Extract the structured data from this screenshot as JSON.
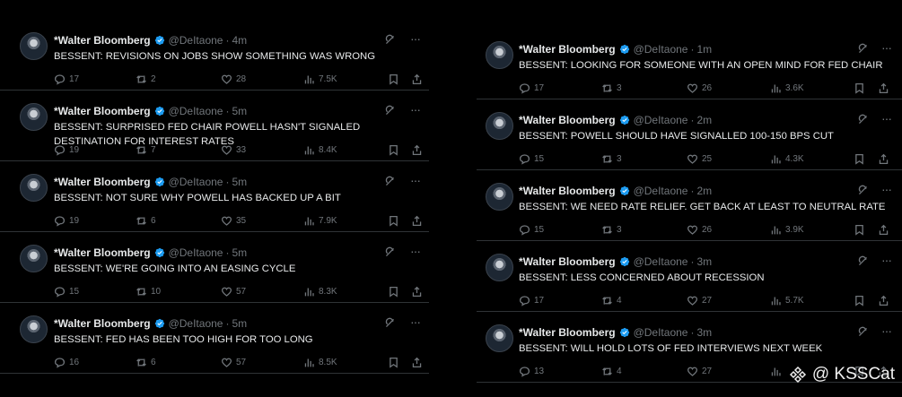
{
  "left_column": [
    {
      "name": "*Walter Bloomberg",
      "handle": "@DeItaone",
      "time": "4m",
      "text": "BESSENT: REVISIONS ON JOBS SHOW SOMETHING WAS WRONG",
      "replies": "17",
      "reposts": "2",
      "likes": "28",
      "views": "7.5K"
    },
    {
      "name": "*Walter Bloomberg",
      "handle": "@DeItaone",
      "time": "5m",
      "text": "BESSENT: SURPRISED FED CHAIR POWELL HASN'T SIGNALED DESTINATION FOR INTEREST RATES",
      "replies": "19",
      "reposts": "7",
      "likes": "33",
      "views": "8.4K"
    },
    {
      "name": "*Walter Bloomberg",
      "handle": "@DeItaone",
      "time": "5m",
      "text": "BESSENT: NOT SURE WHY POWELL HAS BACKED UP A BIT",
      "replies": "19",
      "reposts": "6",
      "likes": "35",
      "views": "7.9K"
    },
    {
      "name": "*Walter Bloomberg",
      "handle": "@DeItaone",
      "time": "5m",
      "text": "BESSENT: WE'RE GOING INTO AN EASING CYCLE",
      "replies": "15",
      "reposts": "10",
      "likes": "57",
      "views": "8.3K"
    },
    {
      "name": "*Walter Bloomberg",
      "handle": "@DeItaone",
      "time": "5m",
      "text": "BESSENT: FED HAS BEEN TOO HIGH FOR TOO LONG",
      "replies": "16",
      "reposts": "6",
      "likes": "57",
      "views": "8.5K"
    }
  ],
  "right_column": [
    {
      "name": "*Walter Bloomberg",
      "handle": "@DeItaone",
      "time": "1m",
      "text": "BESSENT: LOOKING FOR SOMEONE WITH AN OPEN MIND FOR FED CHAIR",
      "replies": "17",
      "reposts": "3",
      "likes": "26",
      "views": "3.6K"
    },
    {
      "name": "*Walter Bloomberg",
      "handle": "@DeItaone",
      "time": "2m",
      "text": "BESSENT: POWELL SHOULD HAVE SIGNALLED 100-150 BPS CUT",
      "replies": "15",
      "reposts": "3",
      "likes": "25",
      "views": "4.3K"
    },
    {
      "name": "*Walter Bloomberg",
      "handle": "@DeItaone",
      "time": "2m",
      "text": "BESSENT: WE NEED RATE RELIEF. GET BACK AT LEAST TO NEUTRAL RATE",
      "replies": "15",
      "reposts": "3",
      "likes": "26",
      "views": "3.9K"
    },
    {
      "name": "*Walter Bloomberg",
      "handle": "@DeItaone",
      "time": "3m",
      "text": "BESSENT: LESS CONCERNED ABOUT RECESSION",
      "replies": "17",
      "reposts": "4",
      "likes": "27",
      "views": "5.7K"
    },
    {
      "name": "*Walter Bloomberg",
      "handle": "@DeItaone",
      "time": "3m",
      "text": "BESSENT: WILL HOLD LOTS OF FED INTERVIEWS NEXT WEEK",
      "replies": "13",
      "reposts": "4",
      "likes": "27",
      "views": ""
    }
  ],
  "watermark": {
    "text": "@ KSSCat"
  },
  "colors": {
    "background": "#000000",
    "text": "#e7e9ea",
    "muted": "#71767b",
    "verified": "#1d9bf0",
    "divider": "#2f3336"
  },
  "icons": [
    "verified-badge-icon",
    "grok-icon",
    "more-icon",
    "reply-icon",
    "repost-icon",
    "like-icon",
    "views-icon",
    "bookmark-icon",
    "share-icon",
    "binance-logo-icon"
  ]
}
